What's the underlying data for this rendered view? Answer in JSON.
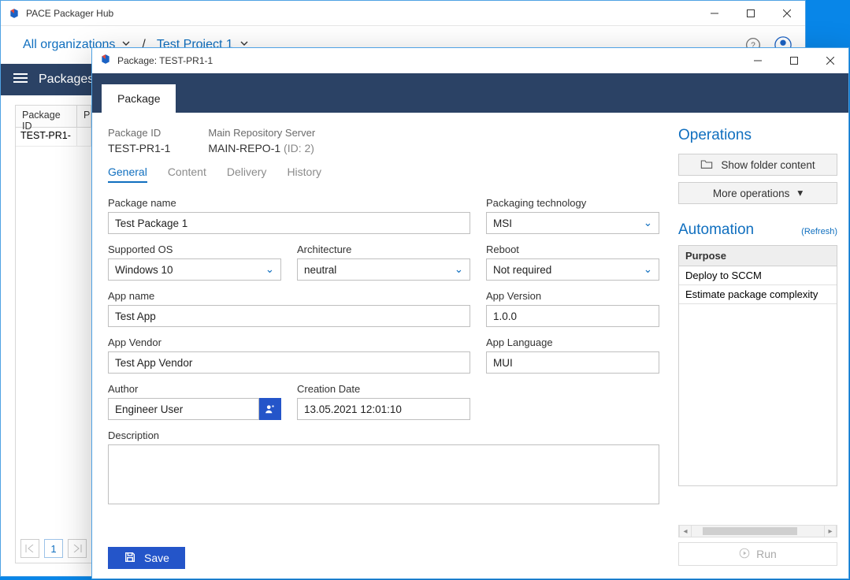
{
  "main_window": {
    "title": "PACE Packager Hub",
    "crumbs": {
      "org": "All organizations",
      "project": "Test Project 1"
    },
    "band_label": "Packages",
    "table": {
      "columns": [
        "Package ID",
        "P"
      ],
      "rows": [
        {
          "id": "TEST-PR1-"
        }
      ]
    },
    "pager": {
      "page": "1"
    }
  },
  "dialog": {
    "title": "Package: TEST-PR1-1",
    "tab": "Package",
    "header": {
      "pkgid_label": "Package ID",
      "pkgid_value": "TEST-PR1-1",
      "repo_label": "Main Repository Server",
      "repo_value": "MAIN-REPO-1",
      "repo_id": " (ID: 2)"
    },
    "subtabs": {
      "general": "General",
      "content": "Content",
      "delivery": "Delivery",
      "history": "History"
    },
    "fields": {
      "package_name": {
        "label": "Package name",
        "value": "Test Package 1"
      },
      "packaging_tech": {
        "label": "Packaging technology",
        "value": "MSI"
      },
      "supported_os": {
        "label": "Supported OS",
        "value": "Windows 10"
      },
      "architecture": {
        "label": "Architecture",
        "value": "neutral"
      },
      "reboot": {
        "label": "Reboot",
        "value": "Not required"
      },
      "app_name": {
        "label": "App name",
        "value": "Test App"
      },
      "app_version": {
        "label": "App Version",
        "value": "1.0.0"
      },
      "app_vendor": {
        "label": "App Vendor",
        "value": "Test App Vendor"
      },
      "app_language": {
        "label": "App Language",
        "value": "MUI"
      },
      "author": {
        "label": "Author",
        "value": "Engineer User"
      },
      "creation_date": {
        "label": "Creation Date",
        "value": "13.05.2021 12:01:10"
      },
      "description": {
        "label": "Description",
        "value": ""
      }
    },
    "save_label": "Save",
    "right": {
      "operations_title": "Operations",
      "show_folder": "Show folder content",
      "more_ops": "More operations",
      "automation_title": "Automation",
      "refresh": "(Refresh)",
      "purpose_header": "Purpose",
      "purposes": [
        "Deploy to SCCM",
        "Estimate package complexity"
      ],
      "run": "Run"
    }
  }
}
